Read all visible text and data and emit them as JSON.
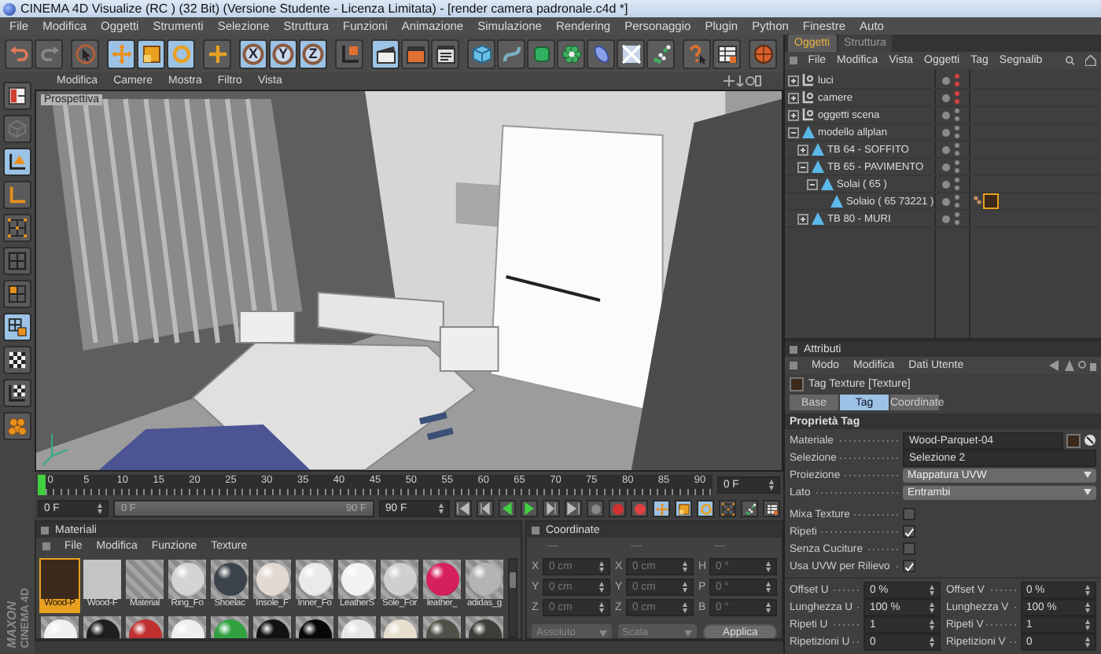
{
  "window": {
    "title": "CINEMA 4D Visualize (RC ) (32 Bit) (Versione Studente - Licenza Limitata) - [render camera padronale.c4d *]"
  },
  "menu": [
    "File",
    "Modifica",
    "Oggetti",
    "Strumenti",
    "Selezione",
    "Struttura",
    "Funzioni",
    "Animazione",
    "Simulazione",
    "Rendering",
    "Personaggio",
    "Plugin",
    "Python",
    "Finestre",
    "Auto"
  ],
  "toolbar": [
    {
      "kind": "undo",
      "selected": false
    },
    {
      "kind": "redo",
      "selected": false
    },
    {
      "kind": "select",
      "selected": false
    },
    {
      "kind": "move",
      "selected": true
    },
    {
      "kind": "scale",
      "selected": true
    },
    {
      "kind": "rotate",
      "selected": true
    },
    {
      "kind": "add",
      "selected": false
    },
    {
      "kind": "axis",
      "label": "X",
      "selected": true
    },
    {
      "kind": "axis",
      "label": "Y",
      "selected": true
    },
    {
      "kind": "axis",
      "label": "Z",
      "selected": true
    },
    {
      "kind": "coords",
      "selected": false
    },
    {
      "kind": "clapper",
      "selected": true
    },
    {
      "kind": "render",
      "selected": false
    },
    {
      "kind": "rsettings",
      "selected": false
    },
    {
      "kind": "cube",
      "selected": false
    },
    {
      "kind": "spline",
      "selected": false
    },
    {
      "kind": "nurbs",
      "selected": false
    },
    {
      "kind": "array",
      "selected": false
    },
    {
      "kind": "deformer",
      "selected": false
    },
    {
      "kind": "scene",
      "selected": false
    },
    {
      "kind": "fx",
      "selected": false
    },
    {
      "kind": "help",
      "selected": false
    },
    {
      "kind": "layout",
      "selected": false
    },
    {
      "kind": "ball",
      "selected": false
    }
  ],
  "viewport": {
    "menu": [
      "Modifica",
      "Camere",
      "Mostra",
      "Filtro",
      "Vista"
    ],
    "camera": "Prospettiva"
  },
  "tools": [
    {
      "kind": "panels",
      "selected": false
    },
    {
      "kind": "mesh",
      "selected": false
    },
    {
      "kind": "model",
      "selected": true
    },
    {
      "kind": "object",
      "selected": false
    },
    {
      "kind": "points",
      "selected": false
    },
    {
      "kind": "edges",
      "selected": false
    },
    {
      "kind": "polygons",
      "selected": false
    },
    {
      "kind": "uv",
      "selected": true
    },
    {
      "kind": "texture",
      "selected": false
    },
    {
      "kind": "texaxis",
      "selected": false
    },
    {
      "kind": "sculpt",
      "selected": false
    }
  ],
  "timeline": {
    "ticks": [
      "0",
      "5",
      "10",
      "15",
      "20",
      "25",
      "30",
      "35",
      "40",
      "45",
      "50",
      "55",
      "60",
      "65",
      "70",
      "75",
      "80",
      "85",
      "90"
    ],
    "level": 0,
    "current": "0 F",
    "start": "0 F",
    "range": {
      "start": "0 F",
      "end": "90 F",
      "level": 1
    },
    "end": "90 F"
  },
  "materials": {
    "title": "Materiali",
    "menu": [
      "File",
      "Modifica",
      "Funzione",
      "Texture"
    ],
    "swatches": [
      {
        "label": "Wood-P",
        "kind": "flat",
        "color": "#3b2a1c",
        "selected": true
      },
      {
        "label": "Wood-F",
        "kind": "flat",
        "color": "#c4c4c4",
        "selected": false
      },
      {
        "label": "Material",
        "kind": "empty",
        "selected": false
      },
      {
        "label": "Ring_Fo",
        "kind": "sphere",
        "color": "#d4d4d4",
        "selected": false
      },
      {
        "label": "Shoelac",
        "kind": "sphere",
        "color": "#3c434c",
        "selected": false
      },
      {
        "label": "Insole_F",
        "kind": "sphere",
        "color": "#e2dad2",
        "selected": false
      },
      {
        "label": "Inner_Fo",
        "kind": "sphere",
        "color": "#eaeaea",
        "selected": false
      },
      {
        "label": "LeatherS",
        "kind": "sphere",
        "color": "#f2f2f2",
        "selected": false
      },
      {
        "label": "Sole_For",
        "kind": "sphere",
        "color": "#cfcfcf",
        "selected": false
      },
      {
        "label": "leather_",
        "kind": "sphere",
        "color": "#d6205c",
        "selected": false
      },
      {
        "label": "adidas_g",
        "kind": "sphere",
        "color": "#b4b4b4",
        "selected": false
      },
      {
        "kind": "sphere",
        "color": "#f0f0f0",
        "selected": false
      },
      {
        "kind": "sphere",
        "color": "#1e1e1e",
        "selected": false
      },
      {
        "kind": "sphere",
        "color": "#c03030",
        "selected": false
      },
      {
        "kind": "sphere",
        "color": "#eeeeee",
        "selected": false
      },
      {
        "kind": "sphere",
        "color": "#30a040",
        "selected": false
      },
      {
        "kind": "sphere",
        "color": "#121212",
        "selected": false
      },
      {
        "kind": "sphere",
        "color": "#080808",
        "selected": false
      },
      {
        "kind": "sphere",
        "color": "#e6e6e6",
        "selected": false
      },
      {
        "kind": "sphere",
        "color": "#e6dece",
        "selected": false
      },
      {
        "kind": "sphere",
        "color": "#505048",
        "selected": false
      },
      {
        "kind": "sphere",
        "color": "#3e3e38",
        "selected": false
      }
    ]
  },
  "coordinates": {
    "title": "Coordinate",
    "columns": [
      "—",
      "—",
      "—"
    ],
    "rows": [
      {
        "cells": [
          {
            "axis": "X",
            "value": "0 cm"
          },
          {
            "axis": "X",
            "value": "0 cm"
          },
          {
            "axis": "H",
            "value": "0 °"
          }
        ]
      },
      {
        "cells": [
          {
            "axis": "Y",
            "value": "0 cm"
          },
          {
            "axis": "Y",
            "value": "0 cm"
          },
          {
            "axis": "P",
            "value": "0 °"
          }
        ]
      },
      {
        "cells": [
          {
            "axis": "Z",
            "value": "0 cm"
          },
          {
            "axis": "Z",
            "value": "0 cm"
          },
          {
            "axis": "B",
            "value": "0 °"
          }
        ]
      }
    ],
    "modes": [
      "Assoluto",
      "Scala"
    ],
    "apply": "Applica",
    "disabled": true
  },
  "logo": {
    "brand": "MAXON",
    "product": "CINEMA 4D"
  },
  "objects": {
    "tabs": [
      {
        "label": "Oggetti",
        "selected": true
      },
      {
        "label": "Struttura",
        "selected": false
      }
    ],
    "menu": [
      "File",
      "Modifica",
      "Vista",
      "Oggetti",
      "Tag",
      "Segnalib"
    ],
    "tree": [
      {
        "label": "luci",
        "kind": "null",
        "expanded": false,
        "color": "#d84040"
      },
      {
        "label": "camere",
        "kind": "null",
        "expanded": false,
        "color": "#d84040"
      },
      {
        "label": "oggetti scena",
        "kind": "null",
        "expanded": false,
        "color": "#8a8a8a"
      },
      {
        "label": "modello allplan",
        "kind": "polygon",
        "expanded": true,
        "color": "#8a8a8a",
        "children": [
          {
            "label": "TB 64 - SOFFITO",
            "kind": "polygon",
            "expanded": false,
            "color": "#8a8a8a"
          },
          {
            "label": "TB 65 - PAVIMENTO",
            "kind": "polygon",
            "expanded": true,
            "color": "#8a8a8a",
            "children": [
              {
                "label": "Solai ( 65 )",
                "kind": "polygon",
                "expanded": true,
                "color": "#8a8a8a",
                "children": [
                  {
                    "label": "Solaio ( 65 73221 )",
                    "kind": "polygon",
                    "color": "#8a8a8a",
                    "tag": true
                  }
                ]
              }
            ]
          },
          {
            "label": "TB 80 - MURI",
            "kind": "polygon",
            "expanded": false,
            "color": "#8a8a8a"
          }
        ]
      }
    ]
  },
  "attributes": {
    "title": "Attributi",
    "menu": [
      "Modo",
      "Modifica",
      "Dati Utente"
    ],
    "object": "Tag Texture [Texture]",
    "tabs": [
      {
        "label": "Base",
        "selected": false
      },
      {
        "label": "Tag",
        "selected": true
      },
      {
        "label": "Coordinate",
        "selected": false
      }
    ],
    "section": "Proprietà Tag",
    "fields": [
      {
        "kind": "link",
        "label": "Materiale",
        "value": "Wood-Parquet-04"
      },
      {
        "kind": "text",
        "label": "Selezione",
        "value": "Selezione 2"
      },
      {
        "kind": "dropdown",
        "label": "Proiezione",
        "value": "Mappatura UVW"
      },
      {
        "kind": "dropdown",
        "label": "Lato",
        "value": "Entrambi"
      }
    ],
    "checks": [
      {
        "label": "Mixa Texture",
        "checked": false
      },
      {
        "label": "Ripeti",
        "checked": true
      },
      {
        "label": "Senza Cuciture",
        "checked": false
      },
      {
        "label": "Usa UVW per Rilievo",
        "checked": true
      }
    ],
    "numbers": [
      {
        "label": "Offset U",
        "value": "0 %"
      },
      {
        "label": "Offset V",
        "value": "0 %"
      },
      {
        "label": "Lunghezza U",
        "value": "100 %"
      },
      {
        "label": "Lunghezza V",
        "value": "100 %"
      },
      {
        "label": "Ripeti U",
        "value": "1"
      },
      {
        "label": "Ripeti V",
        "value": "1"
      },
      {
        "label": "Ripetizioni U",
        "value": "0"
      },
      {
        "label": "Ripetizioni V",
        "value": "0"
      }
    ]
  }
}
